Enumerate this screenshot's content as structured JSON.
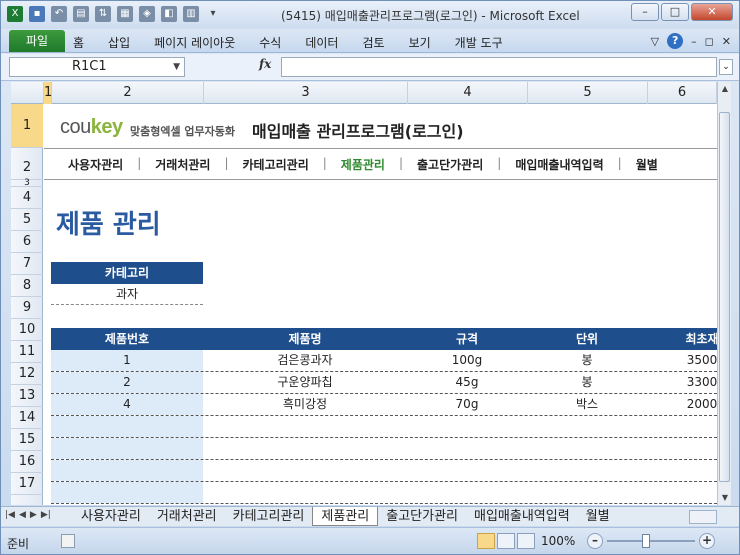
{
  "window": {
    "title": "(5415) 매입매출관리프로그램(로그인) - Microsoft Excel"
  },
  "ribbon": {
    "file_tab": "파일",
    "tabs": [
      "홈",
      "삽입",
      "페이지 레이아웃",
      "수식",
      "데이터",
      "검토",
      "보기",
      "개발 도구"
    ]
  },
  "formula_bar": {
    "name_box": "R1C1",
    "fx": "fx",
    "formula": ""
  },
  "columns": [
    "1",
    "2",
    "3",
    "4",
    "5",
    "6"
  ],
  "rows": [
    "1",
    "2",
    "3",
    "4",
    "5",
    "6",
    "7",
    "8",
    "9",
    "10",
    "11",
    "12",
    "13",
    "14",
    "15",
    "16",
    "17"
  ],
  "header": {
    "brand_logo": "coukey",
    "brand_tagline": "맞춤형엑셀 업무자동화",
    "app_title": "매입매출 관리프로그램(로그인)"
  },
  "nav": [
    "사용자관리",
    "거래처관리",
    "카테고리관리",
    "제품관리",
    "출고단가관리",
    "매입매출내역입력",
    "월별"
  ],
  "nav_active": "제품관리",
  "page_title": "제품 관리",
  "category": {
    "label": "카테고리",
    "value": "과자"
  },
  "table": {
    "headers": [
      "제품번호",
      "제품명",
      "규격",
      "단위",
      "최초재"
    ],
    "rows": [
      [
        "1",
        "검은콩과자",
        "100g",
        "봉",
        "3500"
      ],
      [
        "2",
        "구운양파칩",
        "45g",
        "봉",
        "3300"
      ],
      [
        "4",
        "흑미강정",
        "70g",
        "박스",
        "2000"
      ],
      [
        "",
        "",
        "",
        "",
        ""
      ],
      [
        "",
        "",
        "",
        "",
        ""
      ],
      [
        "",
        "",
        "",
        "",
        ""
      ],
      [
        "",
        "",
        "",
        "",
        ""
      ]
    ]
  },
  "sheet_tabs": [
    "사용자관리",
    "거래처관리",
    "카테고리관리",
    "제품관리",
    "출고단가관리",
    "매입매출내역입력",
    "월별"
  ],
  "active_sheet": "제품관리",
  "status": {
    "ready": "준비",
    "zoom": "100%"
  },
  "colors": {
    "header_blue": "#1f4e8c",
    "title_blue": "#2a5aa0",
    "active_green": "#2e8b2e",
    "file_tab_green": "#1f7a2b"
  }
}
